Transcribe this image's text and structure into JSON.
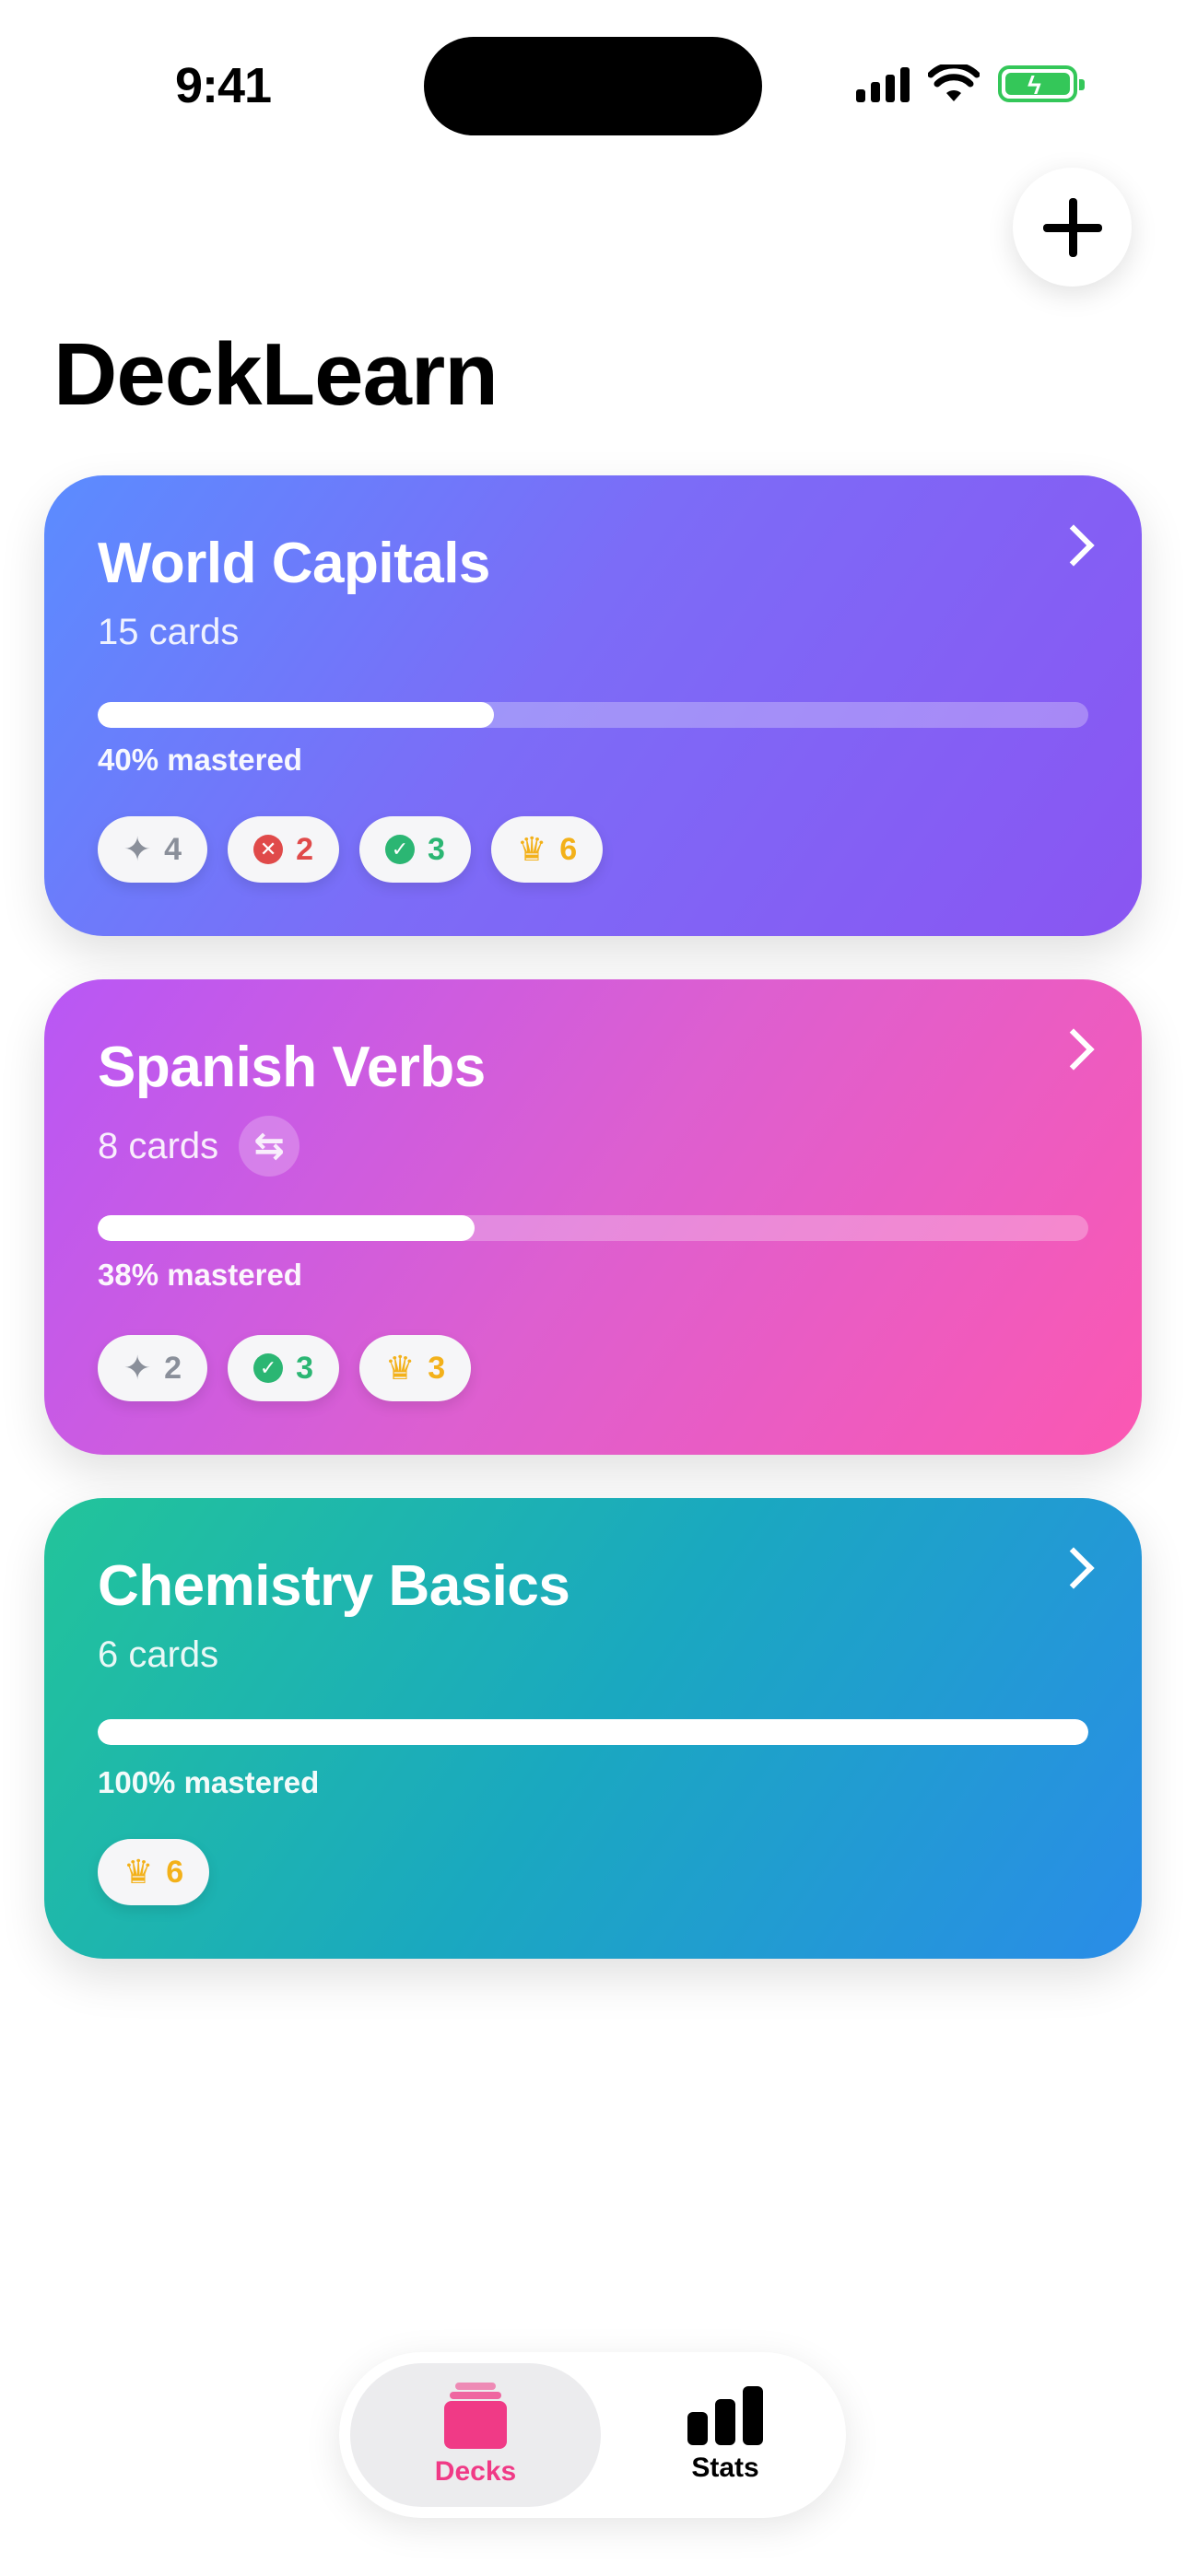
{
  "status_bar": {
    "time": "9:41"
  },
  "header": {
    "title": "DeckLearn",
    "add_icon": "plus-icon"
  },
  "decks": [
    {
      "title": "World Capitals",
      "count_label": "15 cards",
      "mastered_fraction": 0.4,
      "mastered_label": "40% mastered",
      "colors": [
        "#5b8cff",
        "#8a55f2"
      ],
      "badges": {
        "new": "4",
        "wrong": "2",
        "right": "3",
        "mastered": "6"
      }
    },
    {
      "title": "Spanish Verbs",
      "count_label": "8 cards",
      "has_swap_icon": true,
      "mastered_fraction": 0.38,
      "mastered_label": "38% mastered",
      "colors": [
        "#b857f5",
        "#fb58b2"
      ],
      "badges": {
        "new": "2",
        "right": "3",
        "mastered": "3"
      }
    },
    {
      "title": "Chemistry Basics",
      "count_label": "6 cards",
      "mastered_fraction": 1.0,
      "mastered_label": "100% mastered",
      "colors": [
        "#22c49a",
        "#2a8ce8"
      ],
      "badges": {
        "mastered": "6"
      }
    }
  ],
  "tabbar": {
    "tabs": [
      {
        "label": "Decks",
        "icon": "decks-icon",
        "active": true,
        "color": "#f03a86"
      },
      {
        "label": "Stats",
        "icon": "bar-chart-icon",
        "active": false
      }
    ]
  }
}
